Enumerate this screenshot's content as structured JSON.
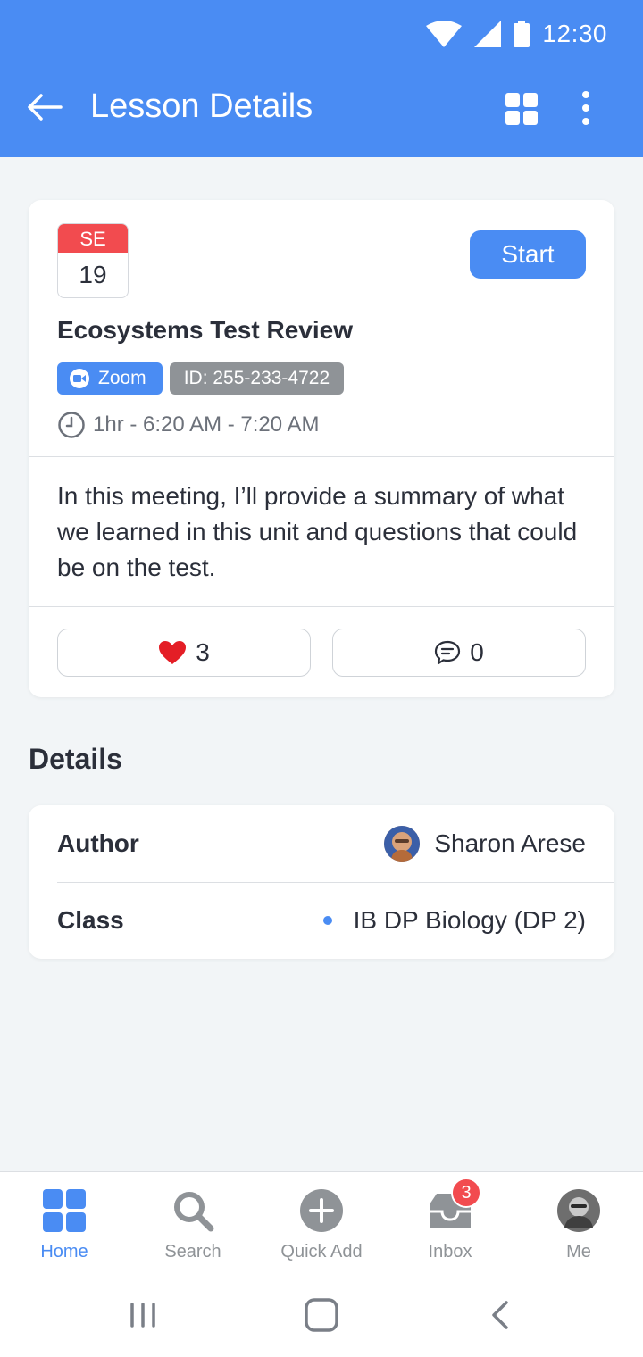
{
  "status_bar": {
    "time": "12:30"
  },
  "header": {
    "title": "Lesson Details"
  },
  "lesson": {
    "calendar_month": "SE",
    "calendar_day": "19",
    "start_label": "Start",
    "title": "Ecosystems Test Review",
    "platform": "Zoom",
    "meeting_id": "ID: 255-233-4722",
    "time": "1hr - 6:20 AM - 7:20 AM",
    "description": "In this meeting, I’ll provide a summary of what  we learned in this unit and questions that could be on the test.",
    "likes": "3",
    "comments": "0"
  },
  "details": {
    "section_title": "Details",
    "author_label": "Author",
    "author_name": "Sharon Arese",
    "class_label": "Class",
    "class_name": "IB DP Biology (DP 2)"
  },
  "bottom_nav": {
    "items": [
      {
        "label": "Home",
        "icon": "home-grid-icon",
        "active": true
      },
      {
        "label": "Search",
        "icon": "search-icon"
      },
      {
        "label": "Quick Add",
        "icon": "plus-circle-icon"
      },
      {
        "label": "Inbox",
        "icon": "inbox-icon",
        "badge": "3"
      },
      {
        "label": "Me",
        "icon": "avatar"
      }
    ]
  },
  "colors": {
    "accent": "#4a8cf3",
    "danger": "#f24b4f",
    "chip_grey": "#8f9397",
    "background": "#f2f5f7"
  }
}
